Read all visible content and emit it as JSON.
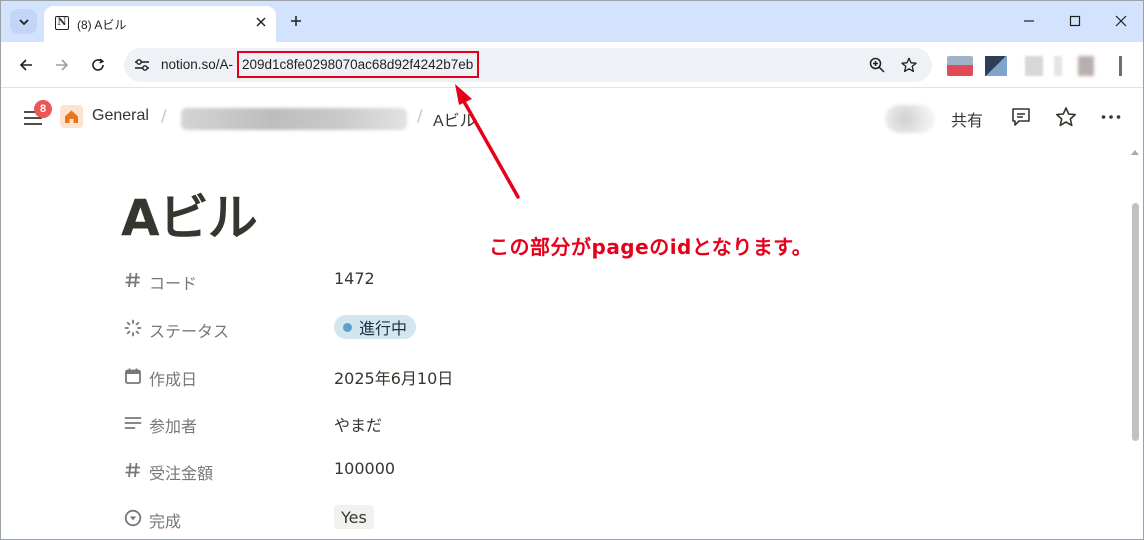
{
  "browser": {
    "tab_title": "(8) Aビル",
    "url_prefix": "notion.so/A-",
    "url_page_id": "209d1c8fe0298070ac68d92f4242b7eb"
  },
  "topbar": {
    "notification_count": "8",
    "workspace": "General",
    "separator": "/",
    "current_page": "Aビル",
    "share_label": "共有"
  },
  "page": {
    "title": "Aビル",
    "properties": [
      {
        "label": "コード",
        "value": "1472",
        "icon": "number-icon"
      },
      {
        "label": "ステータス",
        "value": "進行中",
        "icon": "status-icon"
      },
      {
        "label": "作成日",
        "value": "2025年6月10日",
        "icon": "calendar-icon"
      },
      {
        "label": "参加者",
        "value": "やまだ",
        "icon": "text-icon"
      },
      {
        "label": "受注金額",
        "value": "100000",
        "icon": "number-icon"
      },
      {
        "label": "完成",
        "value": "Yes",
        "icon": "select-icon"
      }
    ]
  },
  "annotation": {
    "text": "この部分がpageのidとなります。",
    "color": "#e6001a"
  },
  "colors": {
    "tabstrip": "#d3e3fd",
    "status_pill": "#d3e5ef",
    "status_dot": "#5e9fcd",
    "badge": "#eb5757"
  }
}
